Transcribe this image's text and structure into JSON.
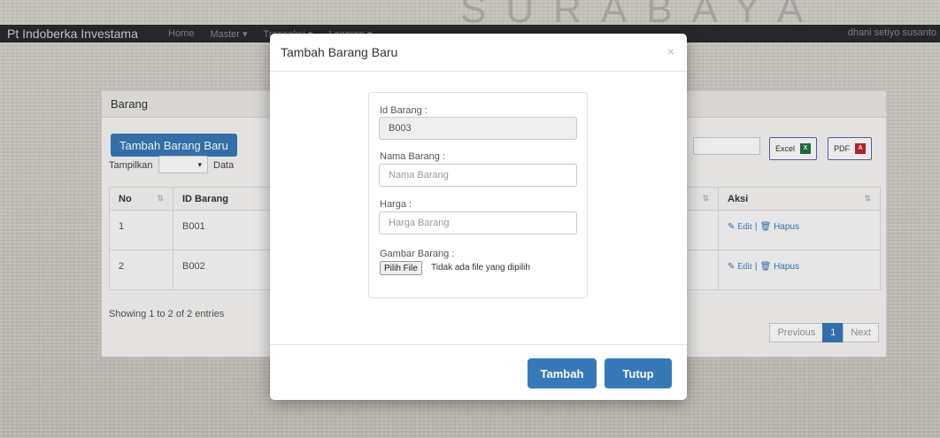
{
  "watermark": "SURABAYA",
  "navbar": {
    "brand": "Pt Indoberka Investama",
    "items": [
      "Home",
      "Master ▾",
      "Transaksi ▾",
      "Laporan ▾"
    ],
    "user": "dhani setiyo susanto"
  },
  "panel": {
    "heading": "Barang",
    "add_button": "Tambah Barang Baru",
    "show_label": "Tampilkan",
    "show_value": "▾",
    "show_suffix": "Data",
    "export": {
      "excel": "Excel",
      "pdf": "PDF"
    },
    "table": {
      "headers": [
        "No",
        "ID Barang",
        "Aksi"
      ],
      "rows": [
        {
          "no": "1",
          "id": "B001",
          "edit": "Edit",
          "sep": "|",
          "delete": "Hapus"
        },
        {
          "no": "2",
          "id": "B002",
          "edit": "Edit",
          "sep": "|",
          "delete": "Hapus"
        }
      ]
    },
    "showing": "Showing 1 to 2 of 2 entries",
    "pagination": {
      "previous": "Previous",
      "current": "1",
      "next": "Next"
    }
  },
  "modal": {
    "title": "Tambah Barang Baru",
    "close": "×",
    "fields": {
      "id_label": "Id Barang :",
      "id_value": "B003",
      "name_label": "Nama Barang :",
      "name_placeholder": "Nama Barang",
      "price_label": "Harga :",
      "price_placeholder": "Harga Barang",
      "image_label": "Gambar Barang :",
      "file_button": "Pilih File",
      "file_text": "Tidak ada file yang dipilih"
    },
    "buttons": {
      "submit": "Tambah",
      "close": "Tutup"
    }
  },
  "colors": {
    "primary": "#3779b8",
    "navbar": "#2b2b2b"
  }
}
